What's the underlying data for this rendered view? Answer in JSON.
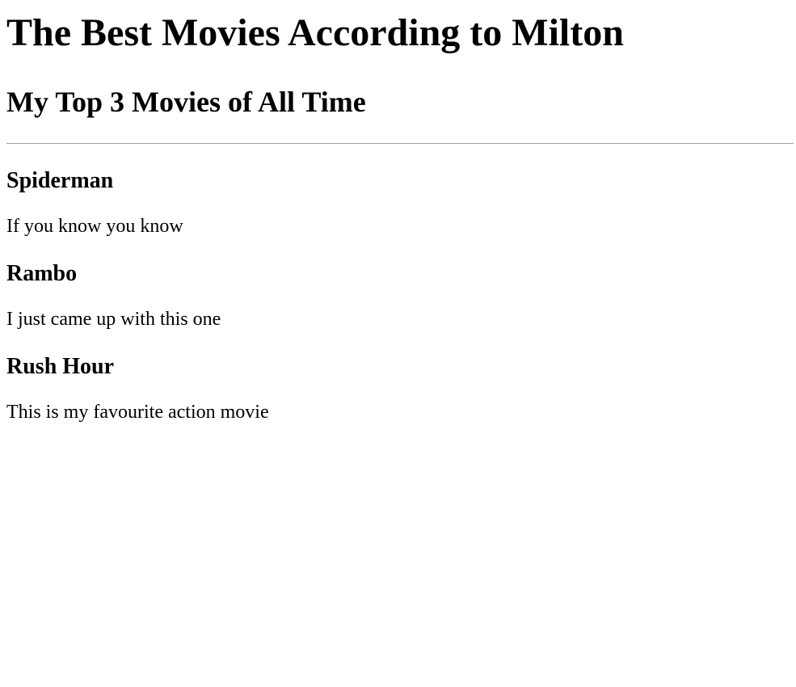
{
  "page": {
    "title": "The Best Movies According to Milton",
    "subtitle": "My Top 3 Movies of All Time"
  },
  "movies": [
    {
      "name": "Spiderman",
      "description": "If you know you know"
    },
    {
      "name": "Rambo",
      "description": "I just came up with this one"
    },
    {
      "name": "Rush Hour",
      "description": "This is my favourite action movie"
    }
  ],
  "colors": {
    "background": "#ffffff",
    "text": "#000000",
    "divider": "#a0a0a0"
  }
}
